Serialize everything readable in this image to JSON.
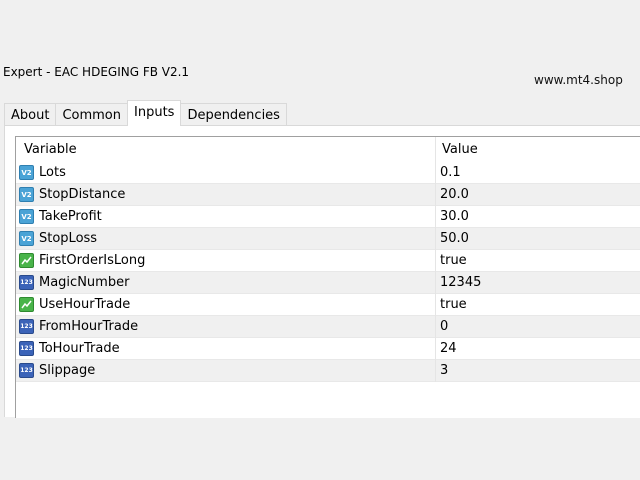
{
  "window": {
    "title": "Expert - EAC HDEGING FB V2.1",
    "watermark": "www.mt4.shop"
  },
  "tabs": [
    {
      "label": "About",
      "active": false
    },
    {
      "label": "Common",
      "active": false
    },
    {
      "label": "Inputs",
      "active": true
    },
    {
      "label": "Dependencies",
      "active": false
    }
  ],
  "table": {
    "columns": [
      "Variable",
      "Value"
    ],
    "rows": [
      {
        "name": "Lots",
        "value": "0.1",
        "icon": "double-var-icon"
      },
      {
        "name": "StopDistance",
        "value": "20.0",
        "icon": "double-var-icon"
      },
      {
        "name": "TakeProfit",
        "value": "30.0",
        "icon": "double-var-icon"
      },
      {
        "name": "StopLoss",
        "value": "50.0",
        "icon": "double-var-icon"
      },
      {
        "name": "FirstOrderIsLong",
        "value": "true",
        "icon": "bool-var-icon"
      },
      {
        "name": "MagicNumber",
        "value": "12345",
        "icon": "int-var-icon"
      },
      {
        "name": "UseHourTrade",
        "value": "true",
        "icon": "bool-var-icon"
      },
      {
        "name": "FromHourTrade",
        "value": "0",
        "icon": "int-var-icon"
      },
      {
        "name": "ToHourTrade",
        "value": "24",
        "icon": "int-var-icon"
      },
      {
        "name": "Slippage",
        "value": "3",
        "icon": "int-var-icon"
      }
    ]
  },
  "colors": {
    "window_bg": "#f0f0f0",
    "double_icon": "#4aa3d6",
    "int_icon": "#3b63b8",
    "bool_icon": "#49b44a"
  }
}
